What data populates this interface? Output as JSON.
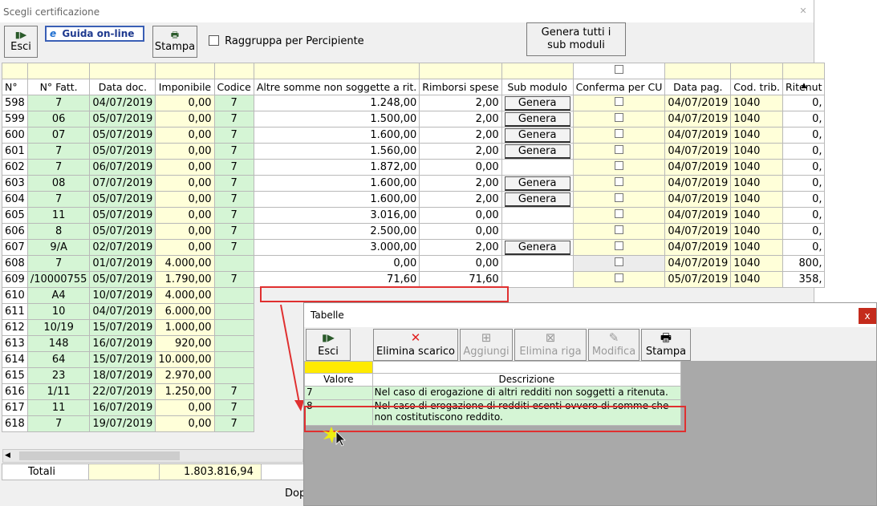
{
  "window": {
    "title": "Scegli certificazione"
  },
  "toolbar": {
    "esci": "Esci",
    "guida": "Guida on-line",
    "stampa": "Stampa",
    "raggruppa": "Raggruppa per Percipiente",
    "genera_tutti": "Genera tutti i sub moduli"
  },
  "columns": [
    "N°",
    "N° Fatt.",
    "Data doc.",
    "Imponibile",
    "Codice",
    "Altre somme non soggette a rit.",
    "Rimborsi spese",
    "Sub modulo",
    "Conferma per CU",
    "Data pag.",
    "Cod. trib.",
    "Ritenut"
  ],
  "rows": [
    {
      "n": "598",
      "fatt": "7",
      "data": "04/07/2019",
      "imp": "0,00",
      "cod": "7",
      "altre": "1.248,00",
      "rimb": "2,00",
      "sub": "Genera",
      "pag": "04/07/2019",
      "trib": "1040",
      "rit": "0,"
    },
    {
      "n": "599",
      "fatt": "06",
      "data": "05/07/2019",
      "imp": "0,00",
      "cod": "7",
      "altre": "1.500,00",
      "rimb": "2,00",
      "sub": "Genera",
      "pag": "04/07/2019",
      "trib": "1040",
      "rit": "0,"
    },
    {
      "n": "600",
      "fatt": "07",
      "data": "05/07/2019",
      "imp": "0,00",
      "cod": "7",
      "altre": "1.600,00",
      "rimb": "2,00",
      "sub": "Genera",
      "pag": "04/07/2019",
      "trib": "1040",
      "rit": "0,"
    },
    {
      "n": "601",
      "fatt": "7",
      "data": "05/07/2019",
      "imp": "0,00",
      "cod": "7",
      "altre": "1.560,00",
      "rimb": "2,00",
      "sub": "Genera",
      "pag": "04/07/2019",
      "trib": "1040",
      "rit": "0,"
    },
    {
      "n": "602",
      "fatt": "7",
      "data": "06/07/2019",
      "imp": "0,00",
      "cod": "7",
      "altre": "1.872,00",
      "rimb": "0,00",
      "sub": "",
      "pag": "04/07/2019",
      "trib": "1040",
      "rit": "0,"
    },
    {
      "n": "603",
      "fatt": "08",
      "data": "07/07/2019",
      "imp": "0,00",
      "cod": "7",
      "altre": "1.600,00",
      "rimb": "2,00",
      "sub": "Genera",
      "pag": "04/07/2019",
      "trib": "1040",
      "rit": "0,"
    },
    {
      "n": "604",
      "fatt": "7",
      "data": "05/07/2019",
      "imp": "0,00",
      "cod": "7",
      "altre": "1.600,00",
      "rimb": "2,00",
      "sub": "Genera",
      "pag": "04/07/2019",
      "trib": "1040",
      "rit": "0,"
    },
    {
      "n": "605",
      "fatt": "11",
      "data": "05/07/2019",
      "imp": "0,00",
      "cod": "7",
      "altre": "3.016,00",
      "rimb": "0,00",
      "sub": "",
      "pag": "04/07/2019",
      "trib": "1040",
      "rit": "0,"
    },
    {
      "n": "606",
      "fatt": "8",
      "data": "05/07/2019",
      "imp": "0,00",
      "cod": "7",
      "altre": "2.500,00",
      "rimb": "0,00",
      "sub": "",
      "pag": "04/07/2019",
      "trib": "1040",
      "rit": "0,"
    },
    {
      "n": "607",
      "fatt": "9/A",
      "data": "02/07/2019",
      "imp": "0,00",
      "cod": "7",
      "altre": "3.000,00",
      "rimb": "2,00",
      "sub": "Genera",
      "pag": "04/07/2019",
      "trib": "1040",
      "rit": "0,"
    },
    {
      "n": "608",
      "fatt": "7",
      "data": "01/07/2019",
      "imp": "4.000,00",
      "cod": "",
      "altre": "0,00",
      "rimb": "0,00",
      "sub": "",
      "pag": "04/07/2019",
      "trib": "1040",
      "rit": "800,"
    },
    {
      "n": "609",
      "fatt": "/10000755",
      "data": "05/07/2019",
      "imp": "1.790,00",
      "cod": "7",
      "altre": "71,60",
      "rimb": "71,60",
      "sub": "",
      "pag": "05/07/2019",
      "trib": "1040",
      "rit": "358,"
    },
    {
      "n": "610",
      "fatt": "A4",
      "data": "10/07/2019",
      "imp": "4.000,00",
      "cod": ""
    },
    {
      "n": "611",
      "fatt": "10",
      "data": "04/07/2019",
      "imp": "6.000,00",
      "cod": ""
    },
    {
      "n": "612",
      "fatt": "10/19",
      "data": "15/07/2019",
      "imp": "1.000,00",
      "cod": ""
    },
    {
      "n": "613",
      "fatt": "148",
      "data": "16/07/2019",
      "imp": "920,00",
      "cod": ""
    },
    {
      "n": "614",
      "fatt": "64",
      "data": "15/07/2019",
      "imp": "10.000,00",
      "cod": ""
    },
    {
      "n": "615",
      "fatt": "23",
      "data": "18/07/2019",
      "imp": "2.970,00",
      "cod": ""
    },
    {
      "n": "616",
      "fatt": "1/11",
      "data": "22/07/2019",
      "imp": "1.250,00",
      "cod": "7"
    },
    {
      "n": "617",
      "fatt": "11",
      "data": "16/07/2019",
      "imp": "0,00",
      "cod": "7"
    },
    {
      "n": "618",
      "fatt": "7",
      "data": "19/07/2019",
      "imp": "0,00",
      "cod": "7"
    }
  ],
  "totals": {
    "label": "Totali",
    "imponibile": "1.803.816,94"
  },
  "footer_partial": "Dop",
  "tabelle": {
    "title": "Tabelle",
    "buttons": {
      "esci": "Esci",
      "elimina_scarico": "Elimina scarico",
      "aggiungi": "Aggiungi",
      "elimina_riga": "Elimina riga",
      "modifica": "Modifica",
      "stampa": "Stampa"
    },
    "columns": {
      "valore": "Valore",
      "descrizione": "Descrizione"
    },
    "rows": [
      {
        "valore": "7",
        "descrizione": "Nel caso di erogazione di altri redditi non soggetti a ritenuta."
      },
      {
        "valore": "8",
        "descrizione": "Nel caso di erogazione di redditi esenti ovvero di somme che non costitutiscono reddito."
      }
    ]
  }
}
